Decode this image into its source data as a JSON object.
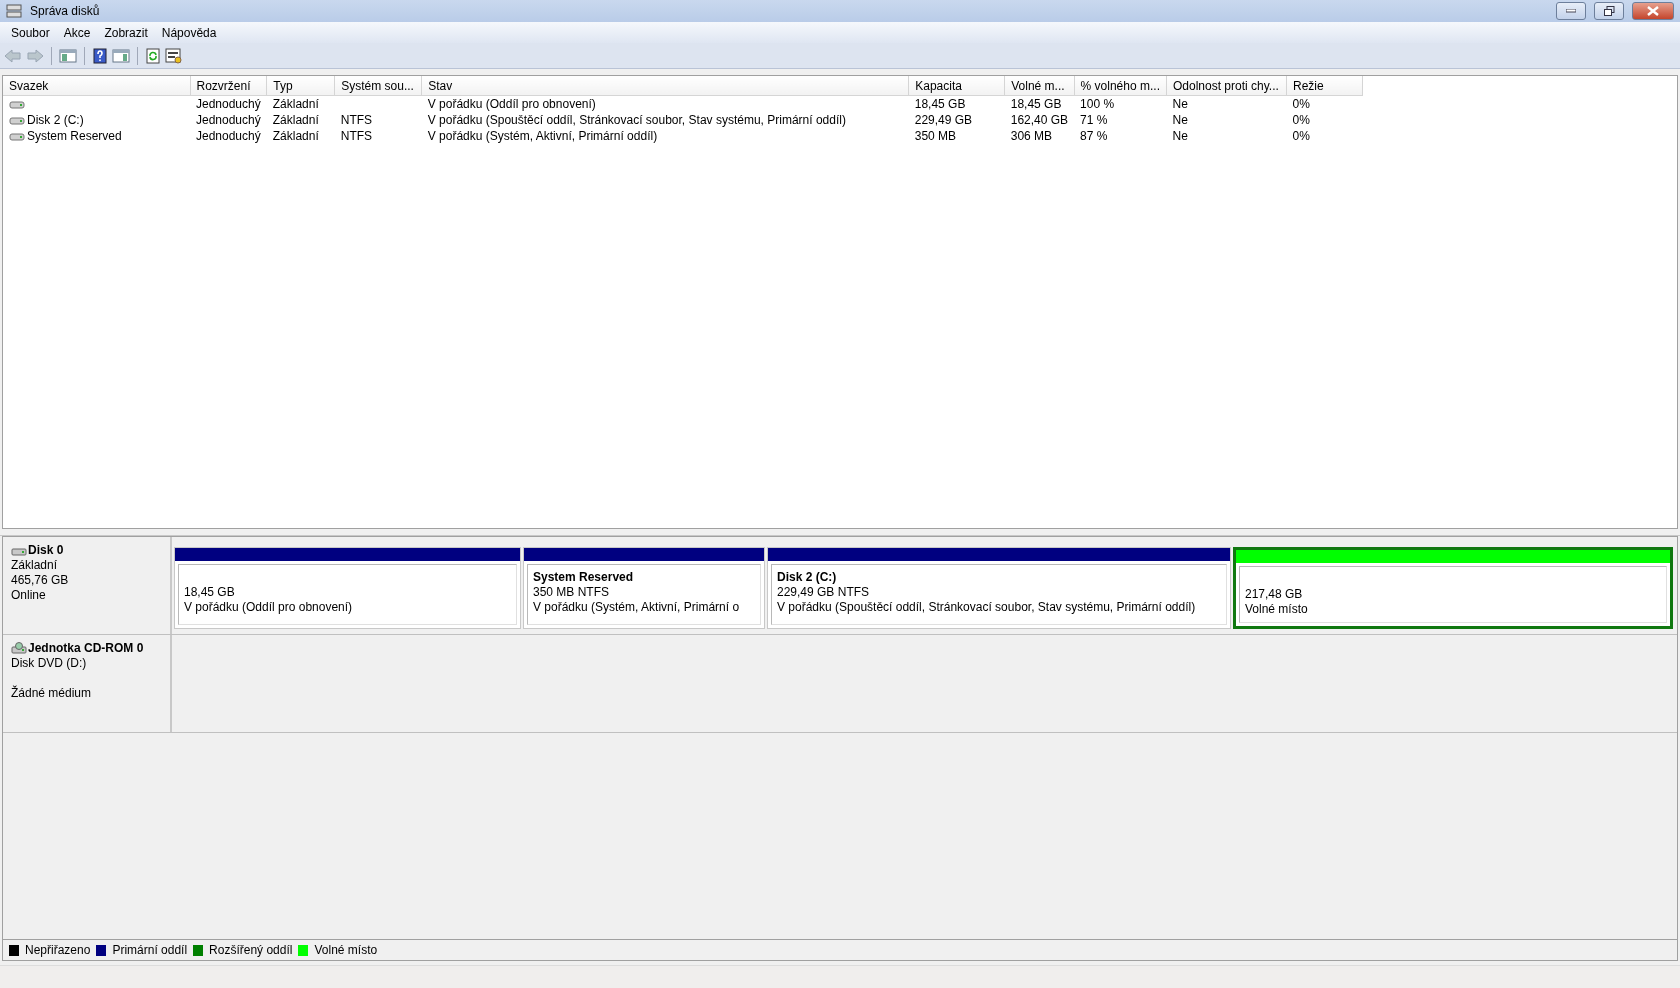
{
  "window": {
    "title": "Správa disků"
  },
  "menu": [
    {
      "label": "Soubor"
    },
    {
      "label": "Akce"
    },
    {
      "label": "Zobrazit"
    },
    {
      "label": "Nápověda"
    }
  ],
  "toolbar": [
    {
      "kind": "back",
      "disabled": true
    },
    {
      "kind": "forward",
      "disabled": true
    },
    {
      "kind": "sep"
    },
    {
      "kind": "tree"
    },
    {
      "kind": "sep"
    },
    {
      "kind": "help"
    },
    {
      "kind": "pane"
    },
    {
      "kind": "sep"
    },
    {
      "kind": "refresh"
    },
    {
      "kind": "properties"
    }
  ],
  "table": {
    "columns": [
      "Svazek",
      "Rozvržení",
      "Typ",
      "Systém sou...",
      "Stav",
      "Kapacita",
      "Volné m...",
      "% volného m...",
      "Odolnost proti chy...",
      "Režie"
    ],
    "rows": [
      {
        "cells": [
          "",
          "Jednoduchý",
          "Základní",
          "",
          "V pořádku (Oddíl pro obnovení)",
          "18,45 GB",
          "18,45 GB",
          "100 %",
          "Ne",
          "0%"
        ]
      },
      {
        "cells": [
          "Disk 2 (C:)",
          "Jednoduchý",
          "Základní",
          "NTFS",
          "V pořádku (Spouštěcí oddíl, Stránkovací soubor, Stav systému, Primární oddíl)",
          "229,49 GB",
          "162,40 GB",
          "71 %",
          "Ne",
          "0%"
        ]
      },
      {
        "cells": [
          "System Reserved",
          "Jednoduchý",
          "Základní",
          "NTFS",
          "V pořádku (Systém, Aktivní, Primární oddíl)",
          "350 MB",
          "306 MB",
          "87 %",
          "Ne",
          "0%"
        ]
      }
    ]
  },
  "disks": [
    {
      "kind": "disk",
      "name": "Disk 0",
      "lines": [
        "Základní",
        "465,76 GB",
        "Online"
      ],
      "partitions": [
        {
          "kind": "primary",
          "selected": false,
          "lines": [
            "18,45 GB",
            "V pořádku (Oddíl pro obnovení)"
          ]
        },
        {
          "kind": "primary",
          "selected": false,
          "title": "System Reserved",
          "lines": [
            "350 MB NTFS",
            "V pořádku (Systém, Aktivní, Primární o"
          ]
        },
        {
          "kind": "primary",
          "selected": false,
          "title": "Disk 2  (C:)",
          "lines": [
            "229,49 GB NTFS",
            "V pořádku (Spouštěcí oddíl, Stránkovací soubor, Stav systému, Primární oddíl)"
          ]
        },
        {
          "kind": "free",
          "selected": true,
          "lines": [
            "217,48 GB",
            "Volné místo"
          ]
        }
      ]
    },
    {
      "kind": "cdrom",
      "name": "Jednotka CD-ROM 0",
      "lines": [
        "Disk DVD (D:)",
        "Žádné médium"
      ]
    }
  ],
  "legend": [
    {
      "label": "Nepřiřazeno",
      "color": "#000000"
    },
    {
      "label": "Primární oddíl",
      "color": "#000080"
    },
    {
      "label": "Rozšířený oddíl",
      "color": "#008000"
    },
    {
      "label": "Volné místo",
      "color": "#00ff00"
    }
  ]
}
